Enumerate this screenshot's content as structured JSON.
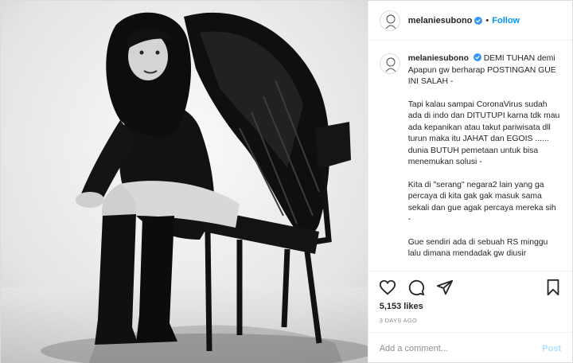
{
  "header": {
    "username": "melaniesubono",
    "separator": "•",
    "follow_label": "Follow",
    "verified_icon": "verified-badge-icon"
  },
  "caption": {
    "username": "melaniesubono",
    "paragraphs": [
      "DEMI TUHAN demi Apapun gw berharap POSTINGAN GUE INI SALAH -",
      "Tapi kalau sampai CoronaVirus sudah ada di indo dan DITUTUPI karna tdk mau ada kepanikan atau takut pariwisata dll turun maka itu JAHAT dan EGOIS ...... dunia BUTUH pemetaan untuk bisa menemukan solusi -",
      "Kita di \"serang\" negara2 lain yang ga percaya di kita gak gak masuk sama sekali dan gue agak percaya mereka sih -",
      "Gue sendiri ada di sebuah RS minggu lalu dimana mendadak gw diusir"
    ]
  },
  "actions": {
    "like_icon": "heart-icon",
    "comment_icon": "comment-icon",
    "share_icon": "share-icon",
    "save_icon": "bookmark-icon",
    "likes": "5,153 likes",
    "timestamp": "3 DAYS AGO"
  },
  "add_comment": {
    "placeholder": "Add a comment...",
    "post_label": "Post"
  },
  "colors": {
    "accent": "#0095f6",
    "post_disabled": "#b2dffc",
    "muted": "#8e8e8e",
    "border": "#efefef"
  }
}
